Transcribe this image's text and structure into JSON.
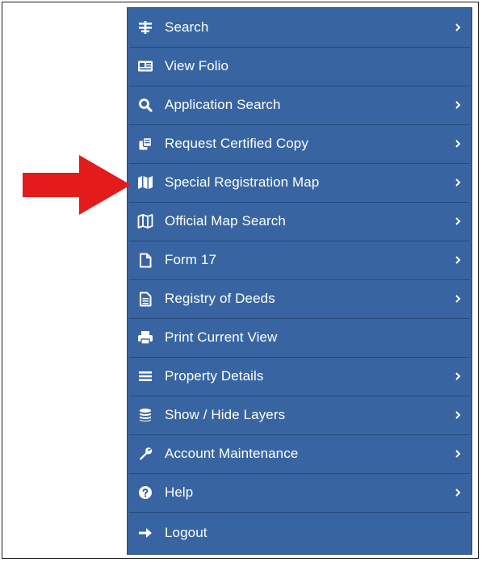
{
  "menu": {
    "items": [
      {
        "label": "Search",
        "icon": "search-filter-icon",
        "has_submenu": true
      },
      {
        "label": "View Folio",
        "icon": "folio-card-icon",
        "has_submenu": false
      },
      {
        "label": "Application Search",
        "icon": "magnifier-icon",
        "has_submenu": true
      },
      {
        "label": "Request Certified Copy",
        "icon": "copy-icon",
        "has_submenu": true
      },
      {
        "label": "Special Registration Map",
        "icon": "map-filled-icon",
        "has_submenu": true
      },
      {
        "label": "Official Map Search",
        "icon": "map-outline-icon",
        "has_submenu": true
      },
      {
        "label": "Form 17",
        "icon": "file-icon",
        "has_submenu": true
      },
      {
        "label": "Registry of Deeds",
        "icon": "document-icon",
        "has_submenu": true
      },
      {
        "label": "Print Current View",
        "icon": "print-icon",
        "has_submenu": false
      },
      {
        "label": "Property Details",
        "icon": "list-icon",
        "has_submenu": true
      },
      {
        "label": "Show / Hide Layers",
        "icon": "layers-icon",
        "has_submenu": true
      },
      {
        "label": "Account Maintenance",
        "icon": "wrench-icon",
        "has_submenu": true
      },
      {
        "label": "Help",
        "icon": "help-icon",
        "has_submenu": true
      },
      {
        "label": "Logout",
        "icon": "logout-arrow-icon",
        "has_submenu": false
      }
    ]
  },
  "annotation": {
    "arrow_color": "#e31b1b",
    "points_to": "Special Registration Map"
  },
  "colors": {
    "menu_bg": "#3865a2",
    "divider": "#27497a",
    "text": "#ffffff"
  }
}
